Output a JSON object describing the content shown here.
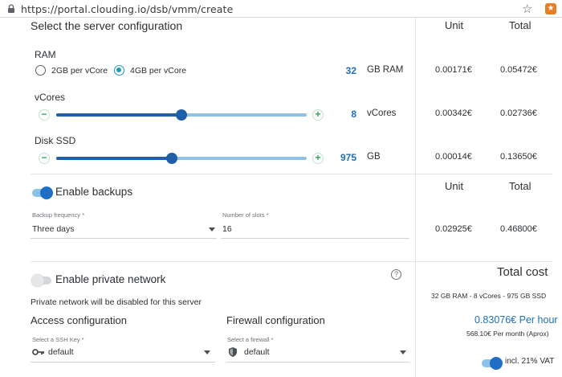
{
  "browser": {
    "url": "https://portal.clouding.io/dsb/vmm/create"
  },
  "server_config": {
    "title": "Select the server configuration",
    "col_unit": "Unit",
    "col_total": "Total",
    "ram": {
      "label": "RAM",
      "option_1": "2GB per vCore",
      "option_2": "4GB per vCore",
      "selected": "4GB per vCore",
      "value": "32",
      "unit": "GB RAM",
      "unit_price": "0.00171€",
      "total_price": "0.05472€"
    },
    "vcores": {
      "label": "vCores",
      "value": "8",
      "unit": "vCores",
      "slider_fraction": 0.5,
      "unit_price": "0.00342€",
      "total_price": "0.02736€"
    },
    "disk": {
      "label": "Disk SSD",
      "value": "975",
      "unit": "GB",
      "slider_fraction": 0.46,
      "unit_price": "0.00014€",
      "total_price": "0.13650€"
    }
  },
  "backups": {
    "toggle_label": "Enable backups",
    "enabled": true,
    "col_unit": "Unit",
    "col_total": "Total",
    "frequency_label": "Backup frequency *",
    "frequency_value": "Three days",
    "slots_label": "Number of slots *",
    "slots_value": "16",
    "unit_price": "0.02925€",
    "total_price": "0.46800€"
  },
  "private_network": {
    "toggle_label": "Enable private network",
    "enabled": false,
    "help_icon": "question-circle-icon",
    "note": "Private network will be disabled for this server"
  },
  "access": {
    "title": "Access configuration",
    "ssh_label": "Select a SSH Key *",
    "ssh_value": "default",
    "ssh_icon": "key-icon"
  },
  "firewall": {
    "title": "Firewall configuration",
    "fw_label": "Select a firewall *",
    "fw_value": "default",
    "fw_icon": "shield-icon"
  },
  "summary": {
    "title": "Total cost",
    "spec": "32 GB RAM - 8 vCores - 975 GB SSD",
    "per_hour": "0.83076€ Per hour",
    "per_month": "568.10€ Per month (Aprox)",
    "vat_label": "incl. 21% VAT",
    "vat_enabled": true
  },
  "colors": {
    "accent": "#1f6fb5",
    "slider": "#1f5fa8",
    "plus": "#2ea65a",
    "radio": "#1e9bb8"
  }
}
